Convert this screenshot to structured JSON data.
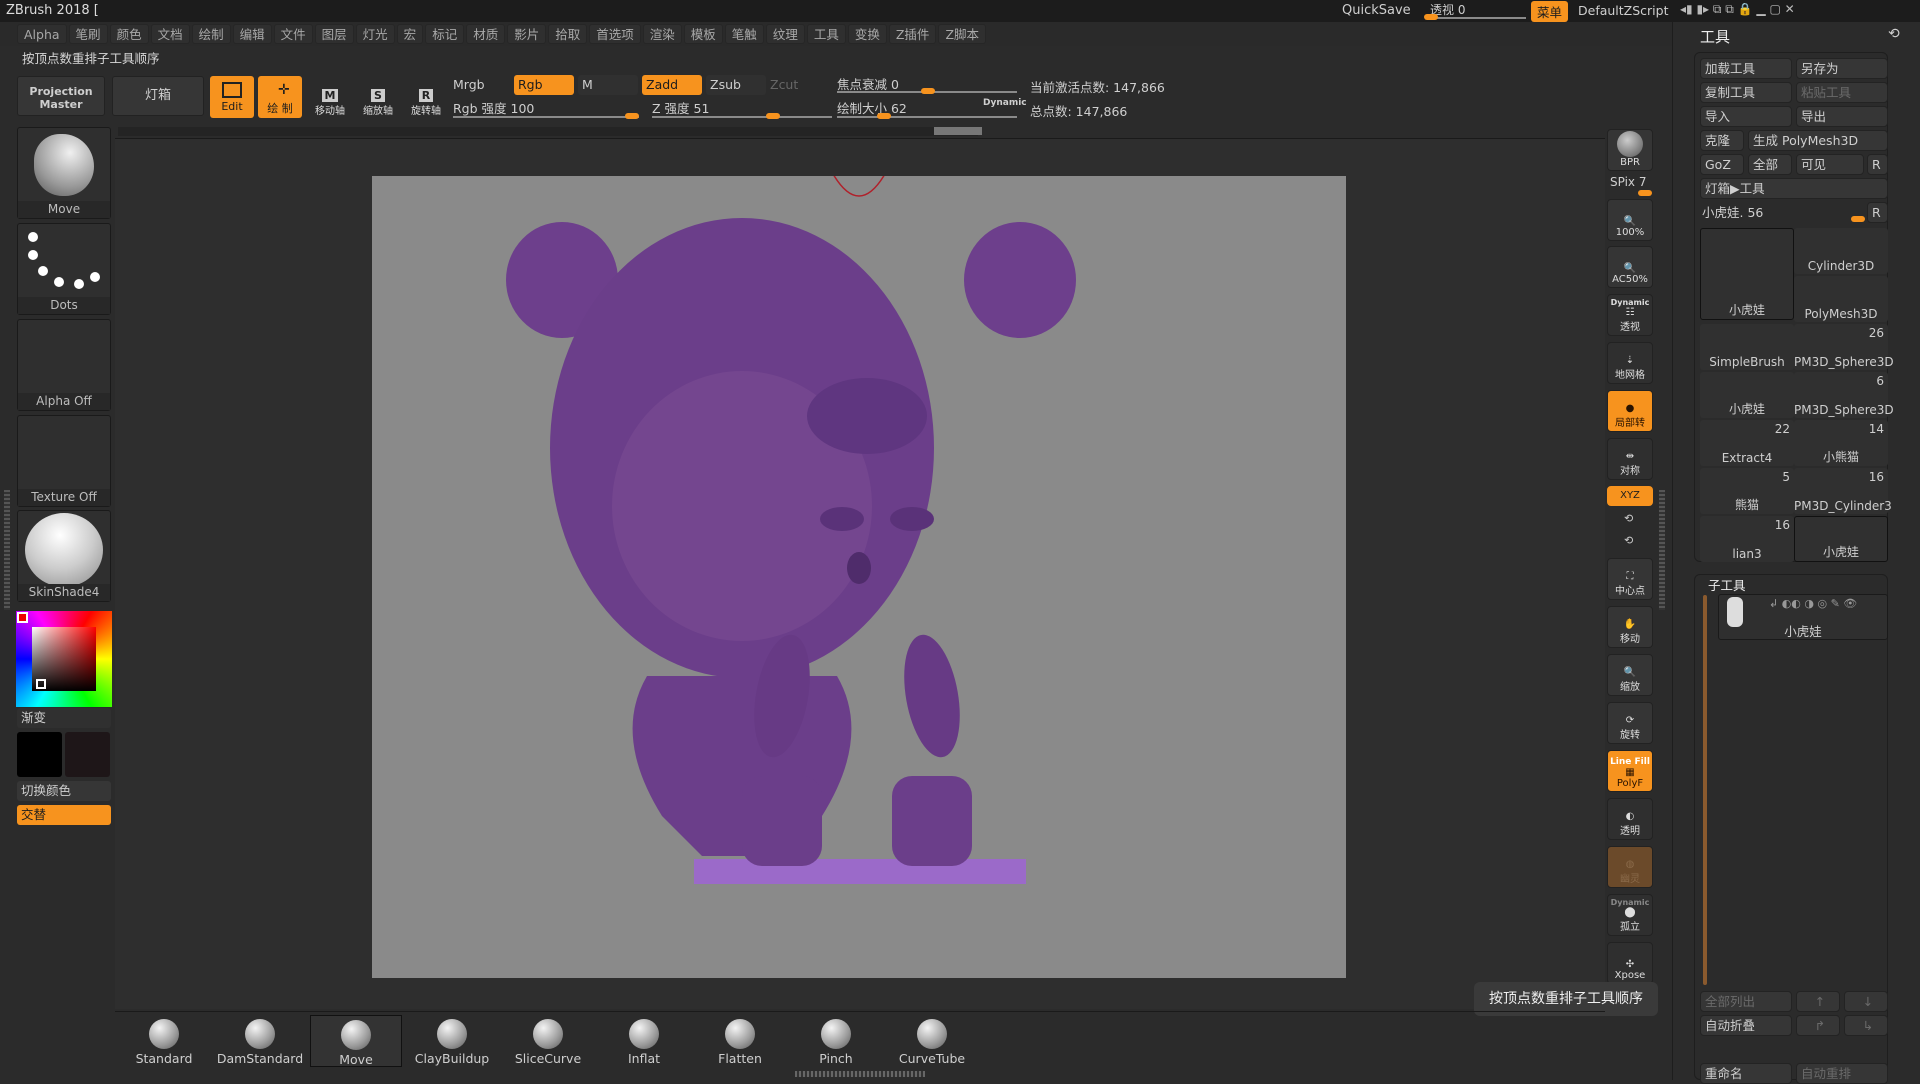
{
  "title_bar": {
    "app_title": "ZBrush 2018 [",
    "quicksave": "QuickSave",
    "perspective_label": "透视 0",
    "menu_button": "菜单",
    "script_name": "DefaultZScript"
  },
  "menubar": [
    "Alpha",
    "笔刷",
    "颜色",
    "文档",
    "绘制",
    "编辑",
    "文件",
    "图层",
    "灯光",
    "宏",
    "标记",
    "材质",
    "影片",
    "拾取",
    "首选项",
    "渲染",
    "模板",
    "笔触",
    "纹理",
    "工具",
    "变换",
    "Z插件",
    "Z脚本"
  ],
  "hint_text": "按顶点数重排子工具顺序",
  "top_shelf": {
    "projection_master": "Projection Master",
    "lightbox": "灯箱",
    "edit": "Edit",
    "draw": "绘 制",
    "move": "移动轴",
    "scale": "缩放轴",
    "rotate": "旋转轴",
    "mrgb": "Mrgb",
    "rgb": "Rgb",
    "m": "M",
    "zadd": "Zadd",
    "zsub": "Zsub",
    "zcut": "Zcut",
    "rgb_intensity": "Rgb 强度 100",
    "z_intensity": "Z 强度 51",
    "focal_shift": "焦点衰减 0",
    "draw_size": "绘制大小 62",
    "dynamic": "Dynamic",
    "active_points": "当前激活点数: 147,866",
    "total_points": "总点数: 147,866",
    "rgb_intensity_value": 100,
    "z_intensity_value": 51,
    "draw_size_value": 62
  },
  "left_panel": {
    "brush": "Move",
    "stroke": "Dots",
    "alpha": "Alpha Off",
    "texture": "Texture Off",
    "material": "SkinShade4",
    "gradient": "渐变",
    "switch_color": "切换颜色",
    "alternate": "交替",
    "main_color": "#000000",
    "secondary_color": "#1e1618"
  },
  "right_toolbar": {
    "bpr": "BPR",
    "spix": "SPix 7",
    "actual": "100%",
    "aahalf": "AC50%",
    "dynamic": "Dynamic",
    "persp": "透视",
    "floor": "地网格",
    "local": "局部转",
    "sym": "对称",
    "xyz": "XYZ",
    "frame": "中心点",
    "move": "移动",
    "scale": "缩放",
    "rotate": "旋转",
    "linefill": "Line Fill",
    "polyf": "PolyF",
    "transp": "透明",
    "ghost": "幽灵",
    "solo_dyn": "Dynamic",
    "solo": "孤立",
    "xpose": "Xpose"
  },
  "tool_panel": {
    "title": "工具",
    "load": "加载工具",
    "save_as": "另存为",
    "copy": "复制工具",
    "paste": "粘贴工具",
    "import": "导入",
    "export": "导出",
    "clone": "克隆",
    "make_polymesh": "生成 PolyMesh3D",
    "goz": "GoZ",
    "all": "全部",
    "visible": "可见",
    "r": "R",
    "lightbox_tools": "灯箱▶工具",
    "current_tool": "小虎娃. 56",
    "tools": [
      {
        "name": "小虎娃",
        "count": ""
      },
      {
        "name": "Cylinder3D",
        "count": ""
      },
      {
        "name": "PolyMesh3D",
        "count": ""
      },
      {
        "name": "SimpleBrush",
        "count": ""
      },
      {
        "name": "PM3D_Sphere3D",
        "count": "26"
      },
      {
        "name": "小虎娃",
        "count": ""
      },
      {
        "name": "PM3D_Sphere3D",
        "count": "6"
      },
      {
        "name": "Extract4",
        "count": "22"
      },
      {
        "name": "小熊猫",
        "count": "14"
      },
      {
        "name": "熊猫",
        "count": "5"
      },
      {
        "name": "PM3D_Cylinder3",
        "count": "16"
      },
      {
        "name": "lian3",
        "count": "16"
      },
      {
        "name": "小虎娃",
        "count": ""
      }
    ],
    "subtool_title": "子工具",
    "subtool_name": "小虎娃",
    "list_all": "全部列出",
    "auto_collapse": "自动折叠",
    "rename": "重命名",
    "auto_reorder": "自动重排"
  },
  "tooltip": "按顶点数重排子工具顺序",
  "brushes": [
    "Standard",
    "DamStandard",
    "Move",
    "ClayBuildup",
    "SliceCurve",
    "Inflat",
    "Flatten",
    "Pinch",
    "CurveTube"
  ],
  "colors": {
    "accent": "#f7931e",
    "model": "#7b4a9c",
    "canvas": "#8a8a8a"
  }
}
